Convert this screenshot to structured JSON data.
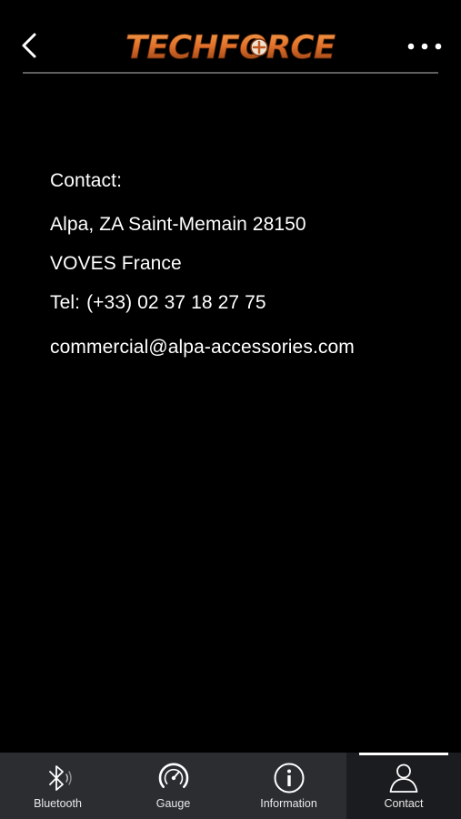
{
  "header": {
    "logo_text": "TECHFORCE",
    "back_icon": "chevron-left-icon",
    "more_icon": "ellipsis-icon"
  },
  "contact": {
    "title": "Contact:",
    "address_line1": "Alpa, ZA Saint-Memain 28150",
    "address_line2": "VOVES France",
    "tel_label": "Tel:",
    "tel_value": "(+33) 02 37 18 27 75",
    "email": "commercial@alpa-accessories.com"
  },
  "tabs": [
    {
      "label": "Bluetooth",
      "icon": "bluetooth-icon",
      "active": false
    },
    {
      "label": "Gauge",
      "icon": "gauge-icon",
      "active": false
    },
    {
      "label": "Information",
      "icon": "info-icon",
      "active": false
    },
    {
      "label": "Contact",
      "icon": "person-icon",
      "active": true
    }
  ],
  "colors": {
    "background": "#000000",
    "tabbar": "#2b2d31",
    "tab_active": "#1b1c1f",
    "logo_orange": "#e8782a",
    "divider": "#5e5e5e"
  }
}
